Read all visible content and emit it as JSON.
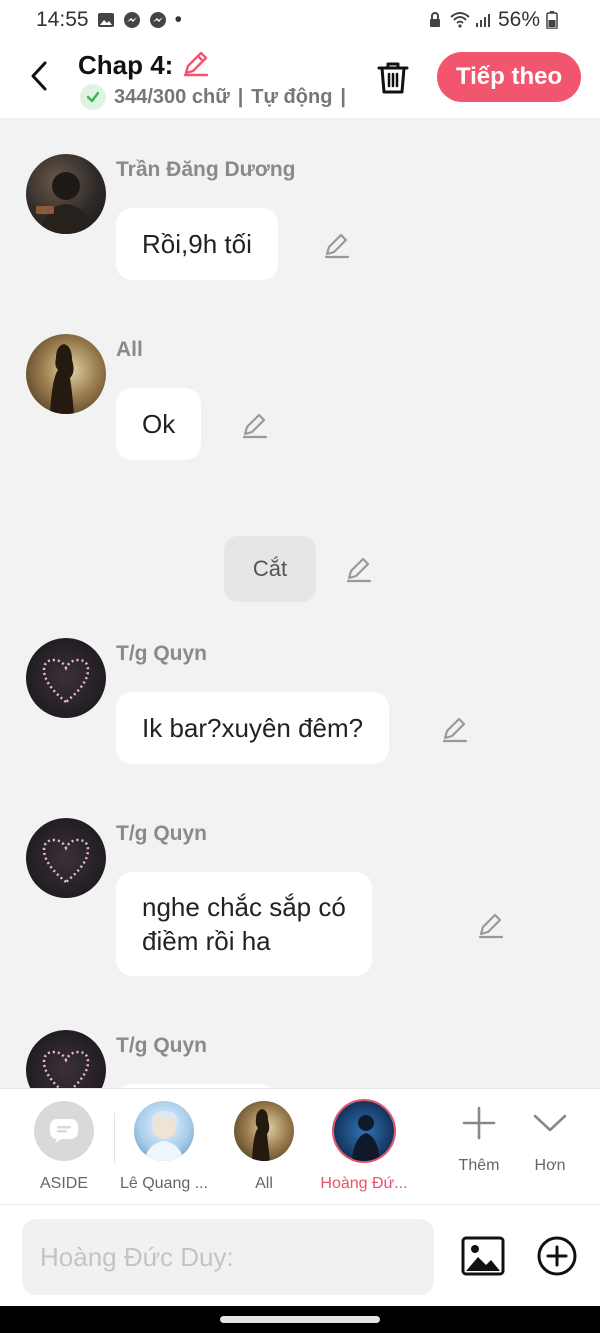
{
  "status_bar": {
    "time": "14:55",
    "dot": "•",
    "battery": "56%"
  },
  "header": {
    "title": "Chap 4:",
    "word_count": "344/300 chữ",
    "separator": "|",
    "mode": "Tự động",
    "trailing": "|",
    "next_button": "Tiếp theo",
    "accent_color": "#f2566f"
  },
  "messages": [
    {
      "sender": "Trần Đăng Dương",
      "text": "Rồi,9h tối"
    },
    {
      "sender": "All",
      "text": "Ok"
    },
    {
      "narration": "Cắt"
    },
    {
      "sender": "T/g Quyn",
      "text": "Ik bar?xuyên đêm?"
    },
    {
      "sender": "T/g Quyn",
      "line1": "nghe chắc sắp có",
      "line2": "điềm rồi ha"
    },
    {
      "sender": "T/g Quyn"
    }
  ],
  "characters": [
    {
      "name": "ASIDE",
      "icon": "chat-bubble-icon"
    },
    {
      "name": "Lê Quang ..."
    },
    {
      "name": "All"
    },
    {
      "name": "Hoàng Đứ...",
      "active": true
    }
  ],
  "tools": {
    "add_label": "Thêm",
    "more_label": "Hơn"
  },
  "input": {
    "placeholder": "Hoàng Đức Duy:"
  }
}
